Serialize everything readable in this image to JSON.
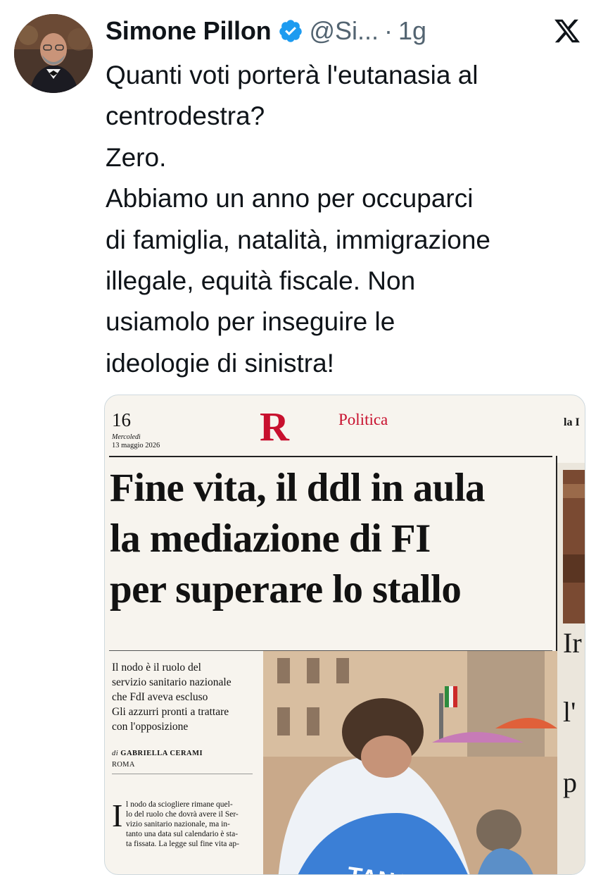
{
  "author": {
    "name": "Simone Pillon",
    "handle": "@Si...",
    "separator": "·",
    "time": "1g"
  },
  "icons": {
    "verified": "verified-badge-icon",
    "platform": "x-logo-icon"
  },
  "tweet": {
    "lines": [
      "Quanti voti porterà l'eutanasia al",
      "centrodestra?",
      "Zero.",
      "Abbiamo un anno per occuparci",
      "di famiglia, natalità, immigrazione",
      "illegale, equità fiscale. Non",
      "usiamolo per inseguire le",
      "ideologie di sinistra!"
    ]
  },
  "newspaper": {
    "page_number": "16",
    "weekday": "Mercoledì",
    "date": "13 maggio 2026",
    "logo": "R",
    "section": "Politica",
    "right_mark": "la I",
    "headline": [
      "Fine vita, il ddl in aula",
      "la mediazione di FI",
      "per superare lo stallo"
    ],
    "summary": [
      "Il nodo è il ruolo del",
      "servizio sanitario nazionale",
      "che FdI aveva escluso",
      "Gli azzurri pronti a trattare",
      "con l'opposizione"
    ],
    "byline_prefix": "di",
    "byline_name": "GABRIELLA CERAMI",
    "city": "ROMA",
    "drop_cap": "I",
    "body_lines": [
      "l nodo da sciogliere rimane quel-",
      "lo del ruolo che dovrà avere il Ser-",
      "vizio sanitario nazionale, ma in-",
      "tanto una data sul calendario è sta-",
      "ta fissata. La legge sul fine vita ap-"
    ],
    "photo_banner_text": "TANASIA",
    "side_letters": [
      "Ir",
      "l'",
      "p"
    ]
  },
  "colors": {
    "text": "#0f1419",
    "muted": "#536471",
    "verified": "#1d9bf0",
    "brand_red": "#c8102e",
    "card_border": "#cfd9de"
  }
}
